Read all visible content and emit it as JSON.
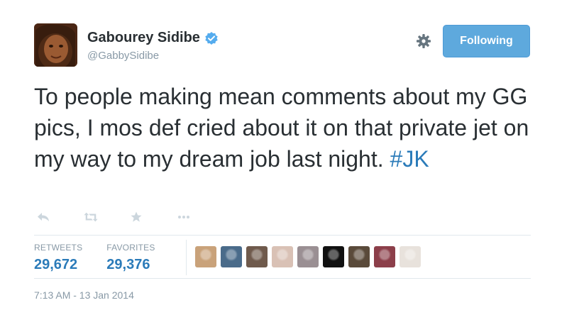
{
  "user": {
    "name": "Gabourey Sidibe",
    "handle": "@GabbySidibe",
    "verified": true
  },
  "follow_button": {
    "label": "Following",
    "color": "#5ea9dd"
  },
  "tweet": {
    "text": "To people making mean comments about my GG pics, I mos def cried about it on that private jet on my way to my dream job last night.",
    "hashtag": "#JK"
  },
  "actions": [
    "reply-icon",
    "retweet-icon",
    "favorite-icon",
    "more-icon"
  ],
  "stats": {
    "retweets_label": "RETWEETS",
    "retweets_count": "29,672",
    "favorites_label": "FAVORITES",
    "favorites_count": "29,376"
  },
  "favoriter_avatars": [
    {
      "color": "#c9a27a"
    },
    {
      "color": "#4a6b8a"
    },
    {
      "color": "#6f5a4c"
    },
    {
      "color": "#d9c1b5"
    },
    {
      "color": "#9a8f93"
    },
    {
      "color": "#111111"
    },
    {
      "color": "#5a4a3a"
    },
    {
      "color": "#8c3f4a"
    },
    {
      "color": "#e8e2dc"
    }
  ],
  "timestamp": "7:13 AM - 13 Jan 2014",
  "colors": {
    "link": "#2b7bb9",
    "muted": "#8899a6",
    "text": "#292f33",
    "border": "#e1e8ed"
  }
}
